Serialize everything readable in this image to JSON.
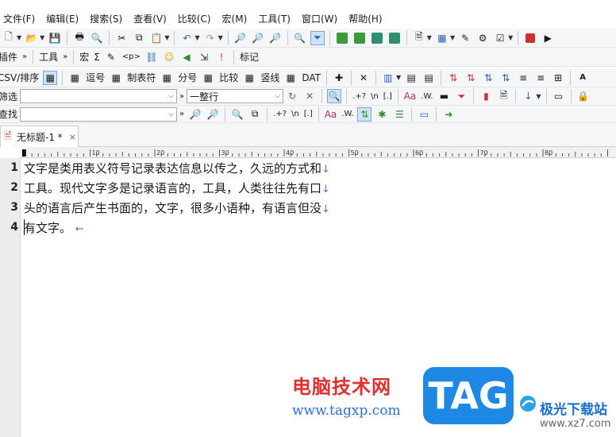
{
  "menu": [
    "文件(F)",
    "编辑(E)",
    "搜索(S)",
    "查看(V)",
    "比较(C)",
    "宏(M)",
    "工具(T)",
    "窗口(W)",
    "帮助(H)"
  ],
  "toolbar2": {
    "plugin_label": "插件",
    "tools_label": "工具",
    "macro_label": "宏",
    "sigma": "Σ",
    "p_tag": "<p>",
    "mark_label": "标记"
  },
  "toolbar3": {
    "csv_label": "CSV/排序",
    "comma_label": "逗号",
    "tab_label": "制表符",
    "semicolon_label": "分号",
    "compare_label": "比较",
    "pipe_label": "竖线",
    "dat_label": "DAT"
  },
  "filter_row": {
    "label": "筛选",
    "input_value": "",
    "mode_value": "一整行",
    "regex": ".+?",
    "newline": "\\n",
    "brackets": "[.]",
    "case": "Aa",
    "word": ".W."
  },
  "find_row": {
    "label": "查找",
    "input_value": "",
    "regex": ".+?",
    "newline": "\\n",
    "brackets": "[.]",
    "case": "Aa",
    "word": ".W."
  },
  "tab": {
    "title": "无标题-1 *",
    "close": "×"
  },
  "ruler": {
    "marks": [
      "10",
      "20",
      "30",
      "40",
      "50",
      "60",
      "70",
      "80"
    ]
  },
  "editor": {
    "lines": [
      {
        "num": "1",
        "text": "文字是类用表义符号记录表达信息以传之，久远的方式和",
        "eol": "↓"
      },
      {
        "num": "2",
        "text": "工具。现代文字多是记录语言的，工具，人类往往先有口",
        "eol": "↓"
      },
      {
        "num": "3",
        "text": "头的语言后产生书面的，文字，很多小语种，有语言但没",
        "eol": "↓"
      },
      {
        "num": "4",
        "text": "有文字。",
        "eol": "←"
      }
    ]
  },
  "watermark": {
    "title": "电脑技术网",
    "url": "www.tagxp.com",
    "badge": "TAG",
    "site_name": "极光下载站",
    "site_url": "www.xz7.com"
  },
  "colors": {
    "accent_blue": "#1e88e5",
    "watermark_red": "#e03030",
    "eol_marker": "#4a78c8"
  }
}
